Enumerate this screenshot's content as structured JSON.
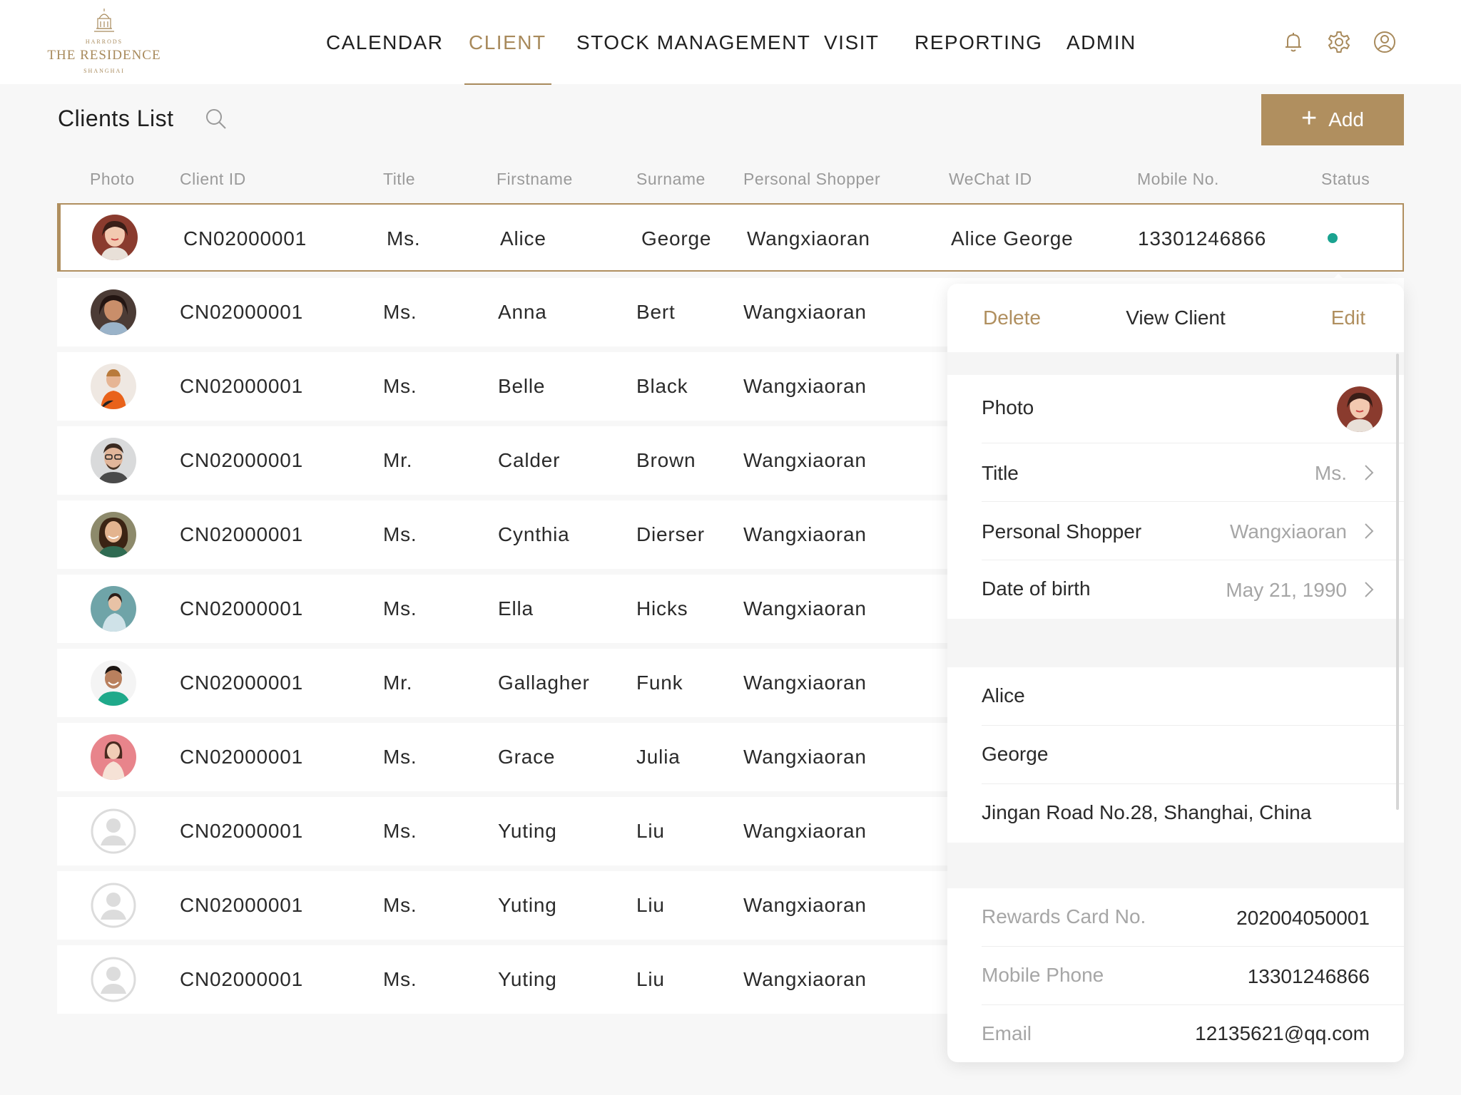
{
  "brand": {
    "top": "HARRODS",
    "main": "THE RESIDENCE",
    "bottom": "SHANGHAI"
  },
  "nav": {
    "items": [
      "CALENDAR",
      "CLIENT",
      "STOCK MANAGEMENT",
      "VISIT",
      "REPORTING",
      "ADMIN"
    ],
    "active": "CLIENT",
    "icons": [
      "bell-icon",
      "gear-icon",
      "user-icon"
    ]
  },
  "header": {
    "title": "Clients List",
    "add_label": "Add"
  },
  "columns": [
    "Photo",
    "Client ID",
    "Title",
    "Firstname",
    "Surname",
    "Personal Shopper",
    "WeChat ID",
    "Mobile No.",
    "Status"
  ],
  "rows": [
    {
      "client_id": "CN02000001",
      "title": "Ms.",
      "firstname": "Alice",
      "surname": "George",
      "shopper": "Wangxiaoran",
      "wechat": "Alice George",
      "mobile": "13301246866",
      "status": "active"
    },
    {
      "client_id": "CN02000001",
      "title": "Ms.",
      "firstname": "Anna",
      "surname": "Bert",
      "shopper": "Wangxiaoran"
    },
    {
      "client_id": "CN02000001",
      "title": "Ms.",
      "firstname": "Belle",
      "surname": "Black",
      "shopper": "Wangxiaoran"
    },
    {
      "client_id": "CN02000001",
      "title": "Mr.",
      "firstname": "Calder",
      "surname": "Brown",
      "shopper": "Wangxiaoran"
    },
    {
      "client_id": "CN02000001",
      "title": "Ms.",
      "firstname": "Cynthia",
      "surname": "Dierser",
      "shopper": "Wangxiaoran"
    },
    {
      "client_id": "CN02000001",
      "title": "Ms.",
      "firstname": "Ella",
      "surname": "Hicks",
      "shopper": "Wangxiaoran"
    },
    {
      "client_id": "CN02000001",
      "title": "Mr.",
      "firstname": "Gallagher",
      "surname": "Funk",
      "shopper": "Wangxiaoran"
    },
    {
      "client_id": "CN02000001",
      "title": "Ms.",
      "firstname": "Grace",
      "surname": "Julia",
      "shopper": "Wangxiaoran"
    },
    {
      "client_id": "CN02000001",
      "title": "Ms.",
      "firstname": "Yuting",
      "surname": "Liu",
      "shopper": "Wangxiaoran"
    },
    {
      "client_id": "CN02000001",
      "title": "Ms.",
      "firstname": "Yuting",
      "surname": "Liu",
      "shopper": "Wangxiaoran"
    },
    {
      "client_id": "CN02000001",
      "title": "Ms.",
      "firstname": "Yuting",
      "surname": "Liu",
      "shopper": "Wangxiaoran"
    }
  ],
  "colors": {
    "accent": "#b08f5f",
    "status_active": "#1aa390"
  },
  "detail": {
    "delete_label": "Delete",
    "title": "View Client",
    "edit_label": "Edit",
    "photo_label": "Photo",
    "title_label": "Title",
    "title_value": "Ms.",
    "shopper_label": "Personal Shopper",
    "shopper_value": "Wangxiaoran",
    "dob_label": "Date of birth",
    "dob_value": "May 21, 1990",
    "firstname": "Alice",
    "surname": "George",
    "address": "Jingan Road No.28, Shanghai, China",
    "rewards_label": "Rewards Card No.",
    "rewards_value": "202004050001",
    "mobile_label": "Mobile Phone",
    "mobile_value": "13301246866",
    "email_label": "Email",
    "email_value": "12135621@qq.com"
  }
}
